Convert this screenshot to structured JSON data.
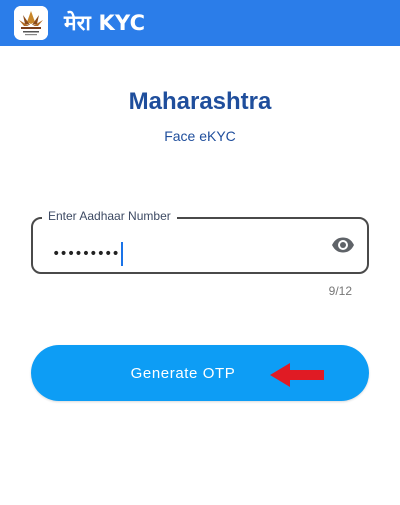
{
  "app_bar": {
    "title": "मेरा KYC",
    "background": "#2b7de9",
    "logo_icon": "lotus-emblem-icon"
  },
  "main": {
    "state_title": "Maharashtra",
    "subtitle": "Face eKYC",
    "title_color": "#1f4e9c"
  },
  "aadhaar_field": {
    "label": "Enter Aadhaar Number",
    "masked_value": "•••••••••",
    "counter": "9/12",
    "toggle_icon": "eye-icon"
  },
  "generate_button": {
    "label": "Generate OTP",
    "color": "#0d9df5"
  },
  "annotation": {
    "icon": "red-arrow-left-icon",
    "color": "#e01b24"
  }
}
